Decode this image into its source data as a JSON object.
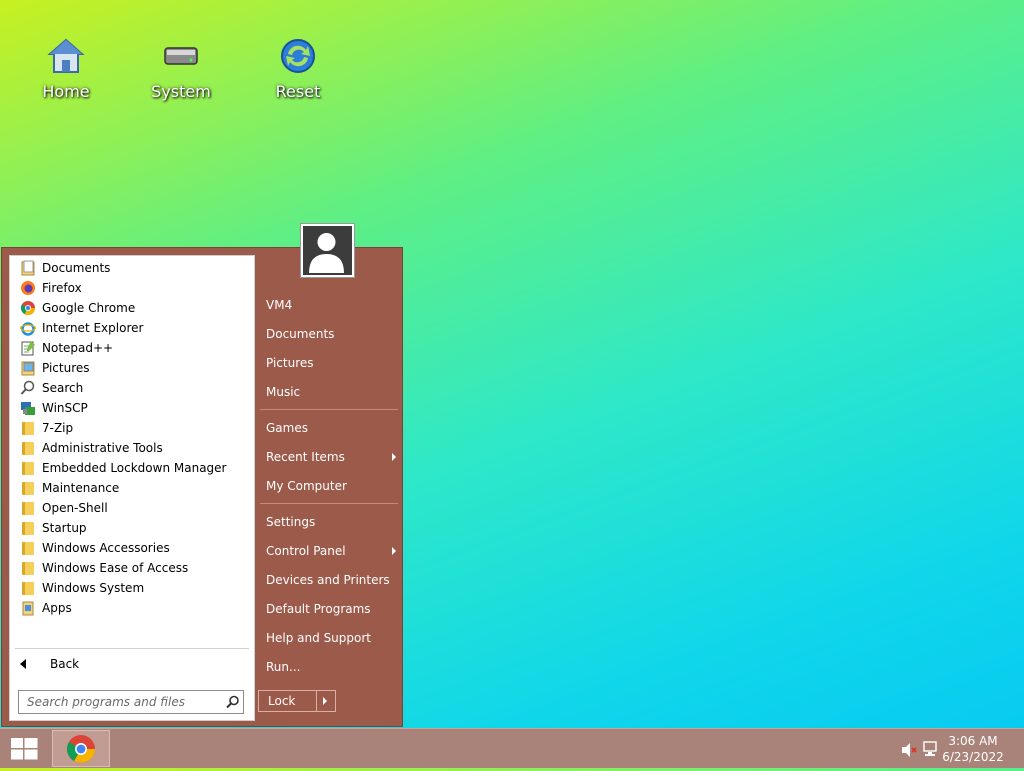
{
  "desktop": {
    "icons": [
      {
        "label": "Home"
      },
      {
        "label": "System"
      },
      {
        "label": "Reset"
      }
    ]
  },
  "start_menu": {
    "programs": [
      {
        "label": "Documents",
        "icon": "documents-icon"
      },
      {
        "label": "Firefox",
        "icon": "firefox-icon"
      },
      {
        "label": "Google Chrome",
        "icon": "chrome-icon"
      },
      {
        "label": "Internet Explorer",
        "icon": "ie-icon"
      },
      {
        "label": "Notepad++",
        "icon": "notepad-icon"
      },
      {
        "label": "Pictures",
        "icon": "pictures-icon"
      },
      {
        "label": "Search",
        "icon": "search-icon"
      },
      {
        "label": "WinSCP",
        "icon": "winscp-icon"
      },
      {
        "label": "7-Zip",
        "icon": "folder-icon"
      },
      {
        "label": "Administrative Tools",
        "icon": "folder-icon"
      },
      {
        "label": "Embedded Lockdown Manager",
        "icon": "folder-icon"
      },
      {
        "label": "Maintenance",
        "icon": "folder-icon"
      },
      {
        "label": "Open-Shell",
        "icon": "folder-icon"
      },
      {
        "label": "Startup",
        "icon": "folder-icon"
      },
      {
        "label": "Windows Accessories",
        "icon": "folder-icon"
      },
      {
        "label": "Windows Ease of Access",
        "icon": "folder-icon"
      },
      {
        "label": "Windows System",
        "icon": "folder-icon"
      },
      {
        "label": "Apps",
        "icon": "apps-icon"
      }
    ],
    "back_label": "Back",
    "search_placeholder": "Search programs and files",
    "right_items": [
      {
        "label": "VM4"
      },
      {
        "label": "Documents"
      },
      {
        "label": "Pictures"
      },
      {
        "label": "Music"
      },
      {
        "label": "Games"
      },
      {
        "label": "Recent Items"
      },
      {
        "label": "My Computer"
      },
      {
        "label": "Settings"
      },
      {
        "label": "Control Panel"
      },
      {
        "label": "Devices and Printers"
      },
      {
        "label": "Default Programs"
      },
      {
        "label": "Help and Support"
      },
      {
        "label": "Run..."
      }
    ],
    "lock_label": "Lock"
  },
  "taskbar": {
    "time": "3:06 AM",
    "date": "6/23/2022"
  },
  "colors": {
    "menu_bg": "#9c5a4a",
    "taskbar_bg": "#a9837a"
  }
}
